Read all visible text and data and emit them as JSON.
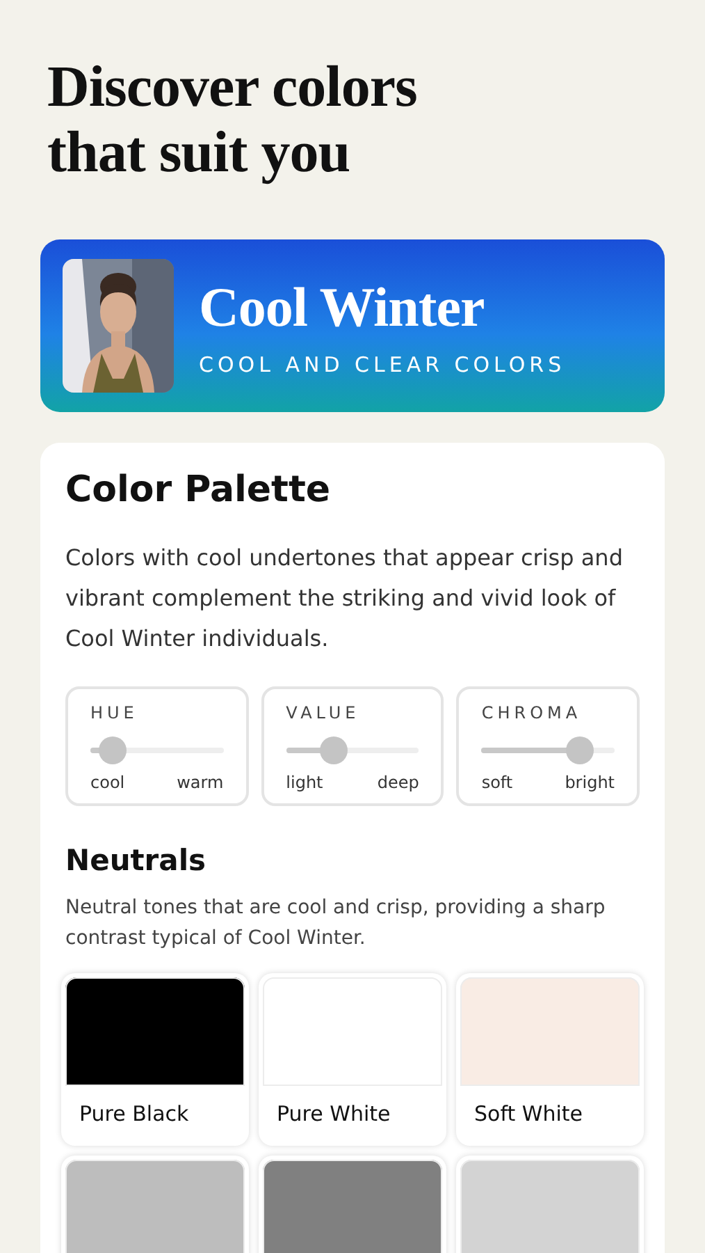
{
  "heading": "Discover colors that suit you",
  "season": {
    "name": "Cool Winter",
    "tagline": "COOL AND CLEAR COLORS"
  },
  "palette": {
    "title": "Color Palette",
    "description": "Colors with cool undertones that appear crisp and vibrant complement the striking and vivid look of Cool Winter individuals.",
    "scales": [
      {
        "label": "HUE",
        "level": 0.17,
        "low": "cool",
        "high": "warm"
      },
      {
        "label": "VALUE",
        "level": 0.36,
        "low": "light",
        "high": "deep"
      },
      {
        "label": "CHROMA",
        "level": 0.74,
        "low": "soft",
        "high": "bright"
      }
    ]
  },
  "neutrals": {
    "title": "Neutrals",
    "description": "Neutral tones that are cool and crisp, providing a sharp contrast typical of Cool Winter.",
    "swatches": [
      {
        "name": "Pure Black",
        "color": "#000000"
      },
      {
        "name": "Pure White",
        "color": "#ffffff"
      },
      {
        "name": "Soft White",
        "color": "#f9ece4"
      },
      {
        "color": "#bdbdbd"
      },
      {
        "color": "#808080"
      },
      {
        "color": "#d3d3d3"
      }
    ]
  }
}
